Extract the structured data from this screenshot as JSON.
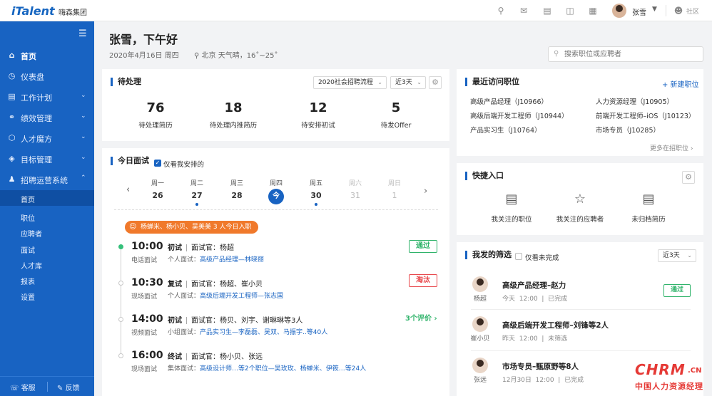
{
  "topbar": {
    "logo": "iTalent",
    "company": "嗨森集团",
    "user_name": "张雪",
    "community": "社区",
    "icons": [
      "search-icon",
      "mail-icon",
      "document-icon",
      "bag-icon",
      "app-store-icon"
    ]
  },
  "sidebar": {
    "items": [
      {
        "label": "首页",
        "icon": "home-icon",
        "active": true
      },
      {
        "label": "仪表盘",
        "icon": "dashboard-icon"
      },
      {
        "label": "工作计划",
        "icon": "plan-icon"
      },
      {
        "label": "绩效管理",
        "icon": "performance-icon"
      },
      {
        "label": "人才魔方",
        "icon": "cube-icon"
      },
      {
        "label": "目标管理",
        "icon": "target-icon"
      },
      {
        "label": "招聘运营系统",
        "icon": "recruit-icon"
      }
    ],
    "subitems": [
      "首页",
      "职位",
      "应聘者",
      "面试",
      "人才库",
      "报表",
      "设置"
    ],
    "bottom": {
      "service": "客服",
      "feedback": "反馈"
    }
  },
  "header": {
    "greeting": "张雪，下午好",
    "date": "2020年4月16日  周四",
    "weather": "北京  天气晴，16˚~25˚"
  },
  "search": {
    "placeholder": "搜索职位或应聘者"
  },
  "pending": {
    "title": "待处理",
    "process_select": "2020社会招聘流程",
    "range_select": "近3天",
    "stats": [
      {
        "value": "76",
        "label": "待处理简历"
      },
      {
        "value": "18",
        "label": "待处理内推简历"
      },
      {
        "value": "12",
        "label": "待安排初试"
      },
      {
        "value": "5",
        "label": "待发Offer"
      }
    ]
  },
  "interviews": {
    "title": "今日面试",
    "only_mine": "仅看我安排的",
    "days": [
      {
        "name": "周一",
        "num": "26",
        "dot": false,
        "dim": false
      },
      {
        "name": "周二",
        "num": "27",
        "dot": true,
        "dim": false
      },
      {
        "name": "周三",
        "num": "28",
        "dot": false,
        "dim": false
      },
      {
        "name": "周四",
        "num": "今",
        "dot": false,
        "dim": false,
        "today": true
      },
      {
        "name": "周五",
        "num": "30",
        "dot": true,
        "dim": false
      },
      {
        "name": "周六",
        "num": "31",
        "dot": false,
        "dim": true
      },
      {
        "name": "周日",
        "num": "1",
        "dot": false,
        "dim": true
      }
    ],
    "banner": "杨蝉米、杨小贝、吴美美 3 人今日入职",
    "list": [
      {
        "time": "10:00",
        "mode": "电话面试",
        "round": "初试",
        "interviewer": "面试官：杨超",
        "sub_prefix": "个人面试：",
        "sub_link": "高级产品经理—林晓丽",
        "stamp": "通过",
        "stamp_type": "pass"
      },
      {
        "time": "10:30",
        "mode": "现场面试",
        "round": "复试",
        "interviewer": "面试官：杨超、崔小贝",
        "sub_prefix": "个人面试：",
        "sub_link": "高级后端开发工程师—张志国",
        "stamp": "淘汰",
        "stamp_type": "out"
      },
      {
        "time": "14:00",
        "mode": "视频面试",
        "round": "初试",
        "interviewer": "面试官：杨贝、刘宇、谢琳琳等3人",
        "sub_prefix": "小组面试：",
        "sub_link": "产品实习生—李磊磊、吴双、马振宇..等40人",
        "evals": "3个评价"
      },
      {
        "time": "16:00",
        "mode": "现场面试",
        "round": "终试",
        "interviewer": "面试官：杨小贝、张远",
        "sub_prefix": "集体面试：",
        "sub_link": "高级设计师…等2个职位—吴玫玫、杨蝉米、伊筱…等24人"
      }
    ]
  },
  "recent_positions": {
    "title": "最近访问职位",
    "new_btn": "+ 新建职位",
    "items": [
      "高级产品经理（J10966）",
      "人力资源经理（J10905）",
      "高级后端开发工程师（J10944）",
      "前端开发工程师–iOS（J10123）",
      "产品实习生（J10764）",
      "市场专员（J10285）"
    ],
    "more": "更多在招职位"
  },
  "quick": {
    "title": "快捷入口",
    "items": [
      {
        "label": "我关注的职位",
        "icon": "followed-position-icon"
      },
      {
        "label": "我关注的应聘者",
        "icon": "followed-candidate-icon"
      },
      {
        "label": "未归档简历",
        "icon": "unarchived-resume-icon"
      }
    ]
  },
  "screening": {
    "title": "我发的筛选",
    "only_unfinished": "仅看未完成",
    "range_select": "近3天",
    "items": [
      {
        "name": "杨超",
        "title": "高级产品经理–赵力",
        "date": "今天",
        "time": "12:00",
        "status": "已完成",
        "stamp": "通过"
      },
      {
        "name": "崔小贝",
        "title": "高级后端开发工程师–刘锋等2人",
        "date": "昨天",
        "time": "12:00",
        "status": "未筛选"
      },
      {
        "name": "张远",
        "title": "市场专员–甄原野等8人",
        "date": "12月30日",
        "time": "12:00",
        "status": "已完成"
      }
    ]
  },
  "watermark": {
    "brand": "CHRM",
    "domain": ".CN",
    "tagline": "中国人力资源经理"
  }
}
